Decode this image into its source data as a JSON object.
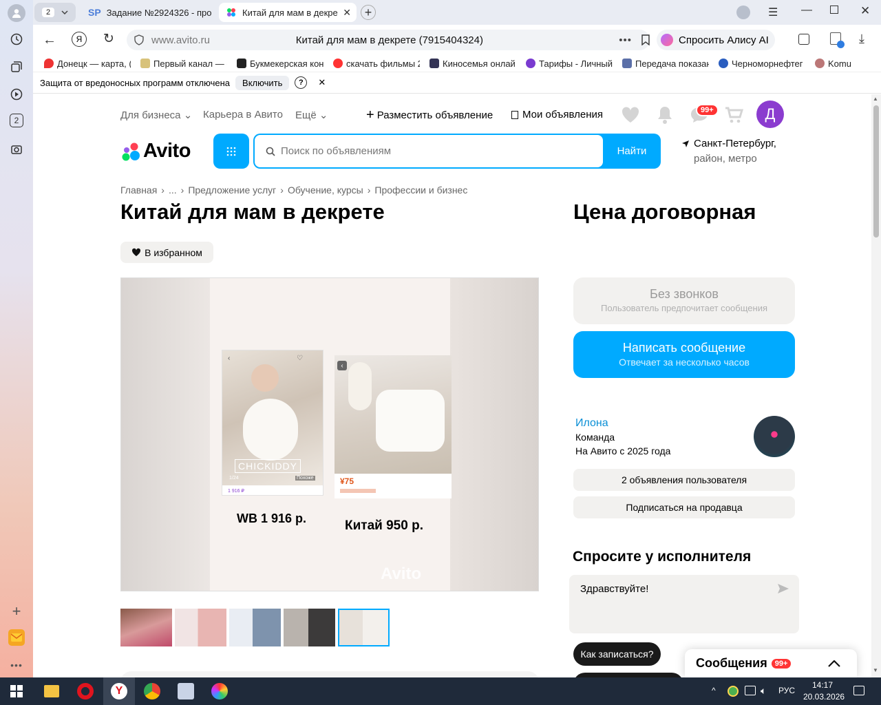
{
  "browser": {
    "tab_count": "2",
    "tabs": [
      {
        "label": "Задание №2924326 - про",
        "favicon": "SP"
      },
      {
        "label": "Китай для мам в декре"
      }
    ],
    "url_domain": "www.avito.ru",
    "page_title": "Китай для мам в декрете (7915404324)",
    "alice_button": "Спросить Алису AI",
    "bookmarks": [
      "Донецк — карта, (",
      "Первый канал — с",
      "Букмекерская кон",
      "скачать фильмы 2",
      "Киносемья онлай",
      "Тарифы - Личный",
      "Передача показан",
      "Черноморнефтег",
      "Komu"
    ],
    "protect_text": "Защита от вредоносных программ отключена",
    "protect_button": "Включить",
    "protect_help": "?"
  },
  "sidebar": {
    "badge": "2"
  },
  "header": {
    "for_business": "Для бизнеса",
    "career": "Карьера в Авито",
    "more": "Ещё",
    "post_ad": "Разместить объявление",
    "my_ads": "Мои объявления",
    "messages_badge": "99+",
    "avatar_letter": "Д"
  },
  "search": {
    "logo": "Avito",
    "placeholder": "Поиск по объявлениям",
    "button": "Найти",
    "location_city": "Санкт-Петербург,",
    "location_sub": "район, метро"
  },
  "breadcrumbs": [
    "Главная",
    "...",
    "Предложение услуг",
    "Обучение, курсы",
    "Профессии и бизнес"
  ],
  "listing": {
    "title": "Китай для мам в декрете",
    "favorite": "В избранном",
    "price": "Цена договорная",
    "image": {
      "label_left": "WB 1 916 р.",
      "label_right": "Китай 950 р.",
      "brand_tag": "CHICKIDDY",
      "similar": "Похоже",
      "counter": "1/24",
      "price_small_left": "1 916 ₽",
      "price_small_right": "¥75",
      "watermark": "Avito"
    }
  },
  "contact": {
    "no_calls_title": "Без звонков",
    "no_calls_sub": "Пользователь предпочитает сообщения",
    "write_title": "Написать сообщение",
    "write_sub": "Отвечает за несколько часов"
  },
  "seller": {
    "name": "Илона",
    "type": "Команда",
    "since": "На Авито с 2025 года",
    "ads_button": "2 объявления пользователя",
    "subscribe_button": "Подписаться на продавца"
  },
  "ask": {
    "title": "Спросите у исполнителя",
    "message": "Здравствуйте!",
    "quick_reply": "Как записаться?"
  },
  "messages_widget": {
    "label": "Сообщения",
    "badge": "99+"
  },
  "taskbar": {
    "lang": "РУС",
    "time": "14:17",
    "date": "20.03.2026"
  },
  "colors": {
    "avito_blue": "#00aaff",
    "brand_purple": "#8b3ccf",
    "badge_red": "#ff3333"
  }
}
